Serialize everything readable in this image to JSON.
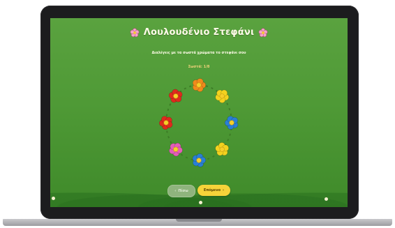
{
  "game": {
    "title": "Λουλουδένιο Στεφάνι",
    "instruction": "Διαλέγεις με τα σωστά χρώματα το στεφάνι σου",
    "counter": "Σωστά: 1/8",
    "back_label": "Πίσω",
    "back_arrow": "‹",
    "next_label": "Επόμενο",
    "next_arrow": "›"
  },
  "wreath": {
    "flowers": [
      {
        "name": "flower-orange-top",
        "color": "#f08a1c"
      },
      {
        "name": "flower-yellow-upper-right",
        "color": "#f3d21f"
      },
      {
        "name": "flower-blue-right",
        "color": "#2a7fd4"
      },
      {
        "name": "flower-yellow-lower-right",
        "color": "#f3d21f"
      },
      {
        "name": "flower-blue-bottom",
        "color": "#2a7fd4"
      },
      {
        "name": "flower-pink-lower-left",
        "color": "#e45db8"
      },
      {
        "name": "flower-red-left",
        "color": "#df2a1d"
      },
      {
        "name": "flower-red-upper-left",
        "color": "#df2a1d"
      }
    ]
  },
  "colors": {
    "background": "#4f9a36",
    "title_text": "#fffbe9",
    "counter_text": "#f0d27a",
    "next_button": "#f6d33a",
    "flower_center": "#f6cf2a",
    "title_flower": "#f3a6c8"
  },
  "icons": {
    "title_left": "pink-flower-icon",
    "title_right": "pink-flower-icon"
  }
}
